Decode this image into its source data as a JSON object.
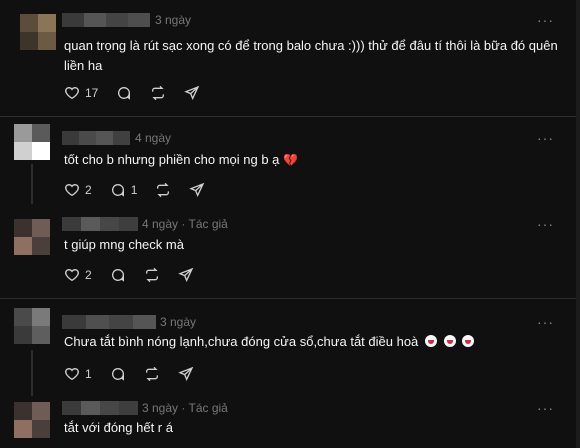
{
  "comments": [
    {
      "time": "3 ngày",
      "author_tag": "",
      "text": "quan trọng là rút sạc xong có để trong balo chưa :))) thử để đâu tí thôi là bữa đó quên liền ha",
      "emoji": "",
      "likes": "17",
      "replies": "",
      "avatar_colors": [
        "#5c4d3a",
        "#8a7556",
        "#3d342a",
        "#6b5a44"
      ]
    },
    {
      "time": "4 ngày",
      "author_tag": "",
      "text": "tốt cho b nhưng phiền cho mọi ng b ạ",
      "emoji": "broken-heart",
      "likes": "2",
      "replies": "1",
      "avatar_colors": [
        "#9a9a9a",
        "#5a5a5a",
        "#d0d0d0",
        "#ffffff"
      ]
    },
    {
      "time": "4 ngày",
      "author_tag": "Tác giả",
      "text": "t giúp mng check mà",
      "emoji": "",
      "likes": "2",
      "replies": "",
      "avatar_colors": [
        "#3b3230",
        "#6e5c55",
        "#8e6f62",
        "#4a3f3a"
      ]
    },
    {
      "time": "3 ngày",
      "author_tag": "",
      "text": "Chưa tắt bình nóng lạnh,chưa đóng cửa sổ,chưa tắt điều hoà",
      "emoji": "clown-x3",
      "likes": "1",
      "replies": "",
      "avatar_colors": [
        "#4a4a4a",
        "#7a7a7a",
        "#3a3a3a",
        "#5e5e5e"
      ]
    },
    {
      "time": "3 ngày",
      "author_tag": "Tác giả",
      "text": "tắt với đóng hết r á",
      "emoji": "",
      "likes": "",
      "replies": "",
      "avatar_colors": [
        "#3b3230",
        "#6e5c55",
        "#8e6f62",
        "#4a3f3a"
      ]
    }
  ],
  "colors": {
    "background": "#101010",
    "text": "#f3f5f7",
    "meta": "#777777",
    "divider": "#2d2d2d"
  },
  "icons": {
    "more": "more-icon",
    "like": "heart-icon",
    "reply": "comment-icon",
    "repost": "repost-icon",
    "share": "share-icon"
  },
  "labels": {
    "more_glyph": "···",
    "separator": "·"
  }
}
